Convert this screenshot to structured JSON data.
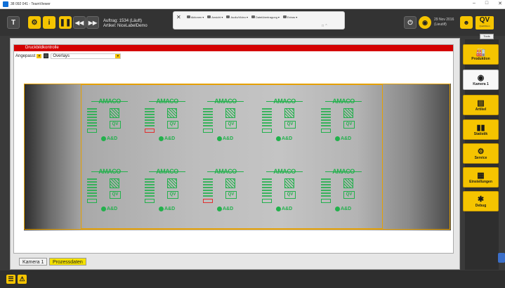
{
  "window": {
    "title": "38 092 041 - TeamViewer",
    "controls": [
      "–",
      "□",
      "✕"
    ]
  },
  "tv_toolbar": {
    "close_glyph": "✕",
    "menus": [
      "Aktionen",
      "Ansicht",
      "Audio/Video",
      "Dateiübertragung",
      "Extras"
    ],
    "pin_glyph": "□ ⌃"
  },
  "header": {
    "job_line1": "Auftrag: 1534 (Läuft)",
    "job_line2": "Artikel:   NiceLabelDemo",
    "datetime_line1": "29 Nov 2016",
    "datetime_line2": "(Lieutilf)",
    "logo_text": "QV",
    "logo_sub": "QualiVision",
    "lang": "Tools"
  },
  "panel": {
    "title": "Druckbildkontrolle",
    "fit_label": "Angepasst",
    "overlay_label": "Overlays"
  },
  "camera": {
    "label_logo": "AMACO",
    "label_qv": "QV",
    "label_ad": "A&D"
  },
  "tabs": {
    "camera": "Kamera 1",
    "process": "Prozessdaten"
  },
  "sidebar": {
    "items": [
      {
        "label": "Produktion",
        "icon": "factory-icon"
      },
      {
        "label": "Kamera 1",
        "icon": "camera-icon"
      },
      {
        "label": "Artikel",
        "icon": "document-icon"
      },
      {
        "label": "Statistik",
        "icon": "bar-chart-icon"
      },
      {
        "label": "Service",
        "icon": "gears-icon"
      },
      {
        "label": "Einstellungen",
        "icon": "settings-panel-icon"
      },
      {
        "label": "Debug",
        "icon": "bug-icon"
      }
    ]
  },
  "colors": {
    "accent": "#f5c400",
    "alert_bar": "#d40000",
    "ok_overlay": "#22b14c"
  }
}
